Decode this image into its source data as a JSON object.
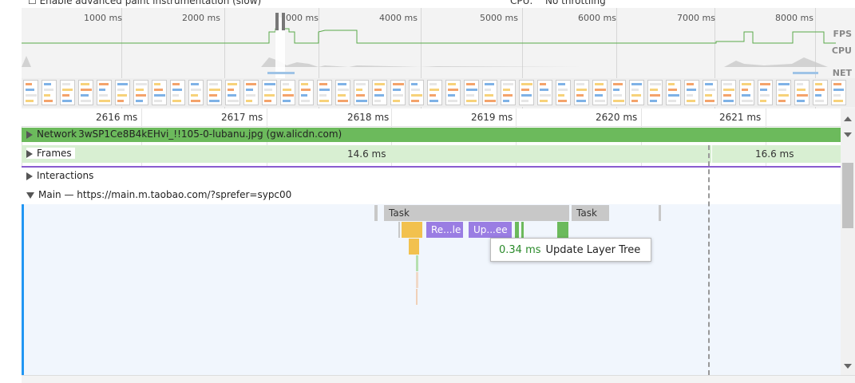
{
  "toolbar": {
    "paint_instrumentation_label": "Enable advanced paint instrumentation (slow)",
    "cpu_label": "CPU:",
    "cpu_value": "No throttling"
  },
  "overview": {
    "ticks": [
      "1000 ms",
      "2000 ms",
      "000 ms",
      "4000 ms",
      "5000 ms",
      "6000 ms",
      "7000 ms",
      "8000 ms"
    ],
    "labels": {
      "fps": "FPS",
      "cpu": "CPU",
      "net": "NET"
    }
  },
  "ruler": {
    "ticks": [
      "2616 ms",
      "2617 ms",
      "2618 ms",
      "2619 ms",
      "2620 ms",
      "2621 ms"
    ]
  },
  "tracks": {
    "network": {
      "label": "Network",
      "request": "3wSP1Ce8B4kEHvi_!!105-0-lubanu.jpg (gw.alicdn.com)"
    },
    "frames": {
      "label": "Frames",
      "durations": [
        "14.6 ms",
        "16.6 ms"
      ]
    },
    "interactions": {
      "label": "Interactions"
    },
    "main": {
      "label": "Main — https://main.m.taobao.com/?sprefer=sypc00"
    }
  },
  "flame": {
    "task1": "Task",
    "task2": "Task",
    "recalc_style": "Re...le",
    "update_layer": "Up...ee"
  },
  "tooltip": {
    "duration": "0.34 ms",
    "name": "Update Layer Tree"
  },
  "colors": {
    "scripting": "#f2c14e",
    "rendering": "#9a7de3",
    "painting": "#6cba5c",
    "task": "#c8c8c8",
    "main_bg": "#f1f6fd"
  }
}
